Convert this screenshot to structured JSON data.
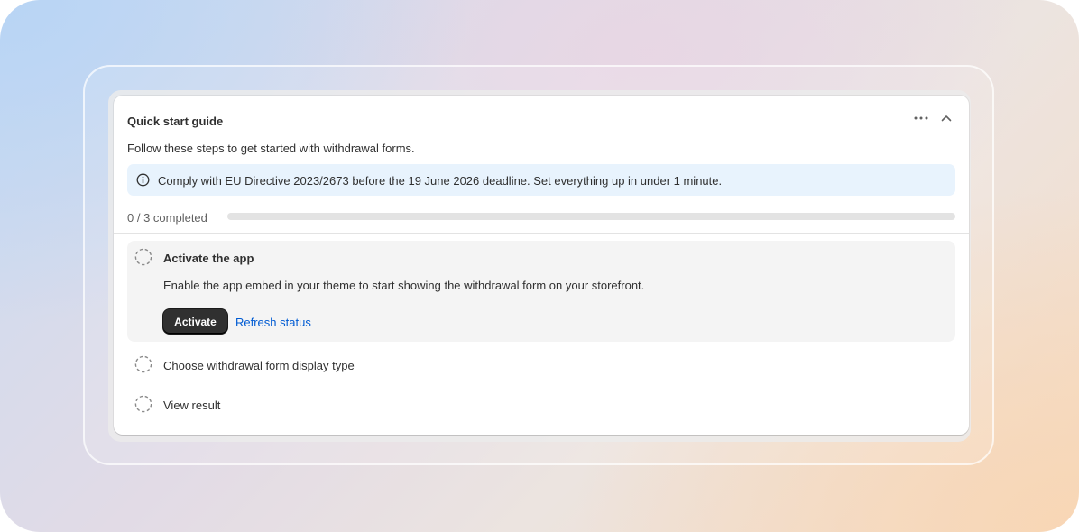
{
  "guide": {
    "title": "Quick start guide",
    "description": "Follow these steps to get started with withdrawal forms.",
    "banner": "Comply with EU Directive 2023/2673 before the 19 June 2026 deadline. Set everything up in under 1 minute.",
    "progress_label": "0 / 3 completed",
    "progress_fraction": 0,
    "menu_icon": "ellipsis-icon",
    "collapse_icon": "chevron-up-icon"
  },
  "steps": [
    {
      "title": "Activate the app",
      "description": "Enable the app embed in your theme to start showing the withdrawal form on your storefront.",
      "primary_action": "Activate",
      "secondary_action": "Refresh status",
      "expanded": true,
      "completed": false
    },
    {
      "title": "Choose withdrawal form display type",
      "expanded": false,
      "completed": false
    },
    {
      "title": "View result",
      "expanded": false,
      "completed": false
    }
  ],
  "colors": {
    "primary_button": "#303030",
    "link": "#005bd3",
    "banner_bg": "#e8f3fd",
    "progress_track": "#e3e3e3"
  }
}
